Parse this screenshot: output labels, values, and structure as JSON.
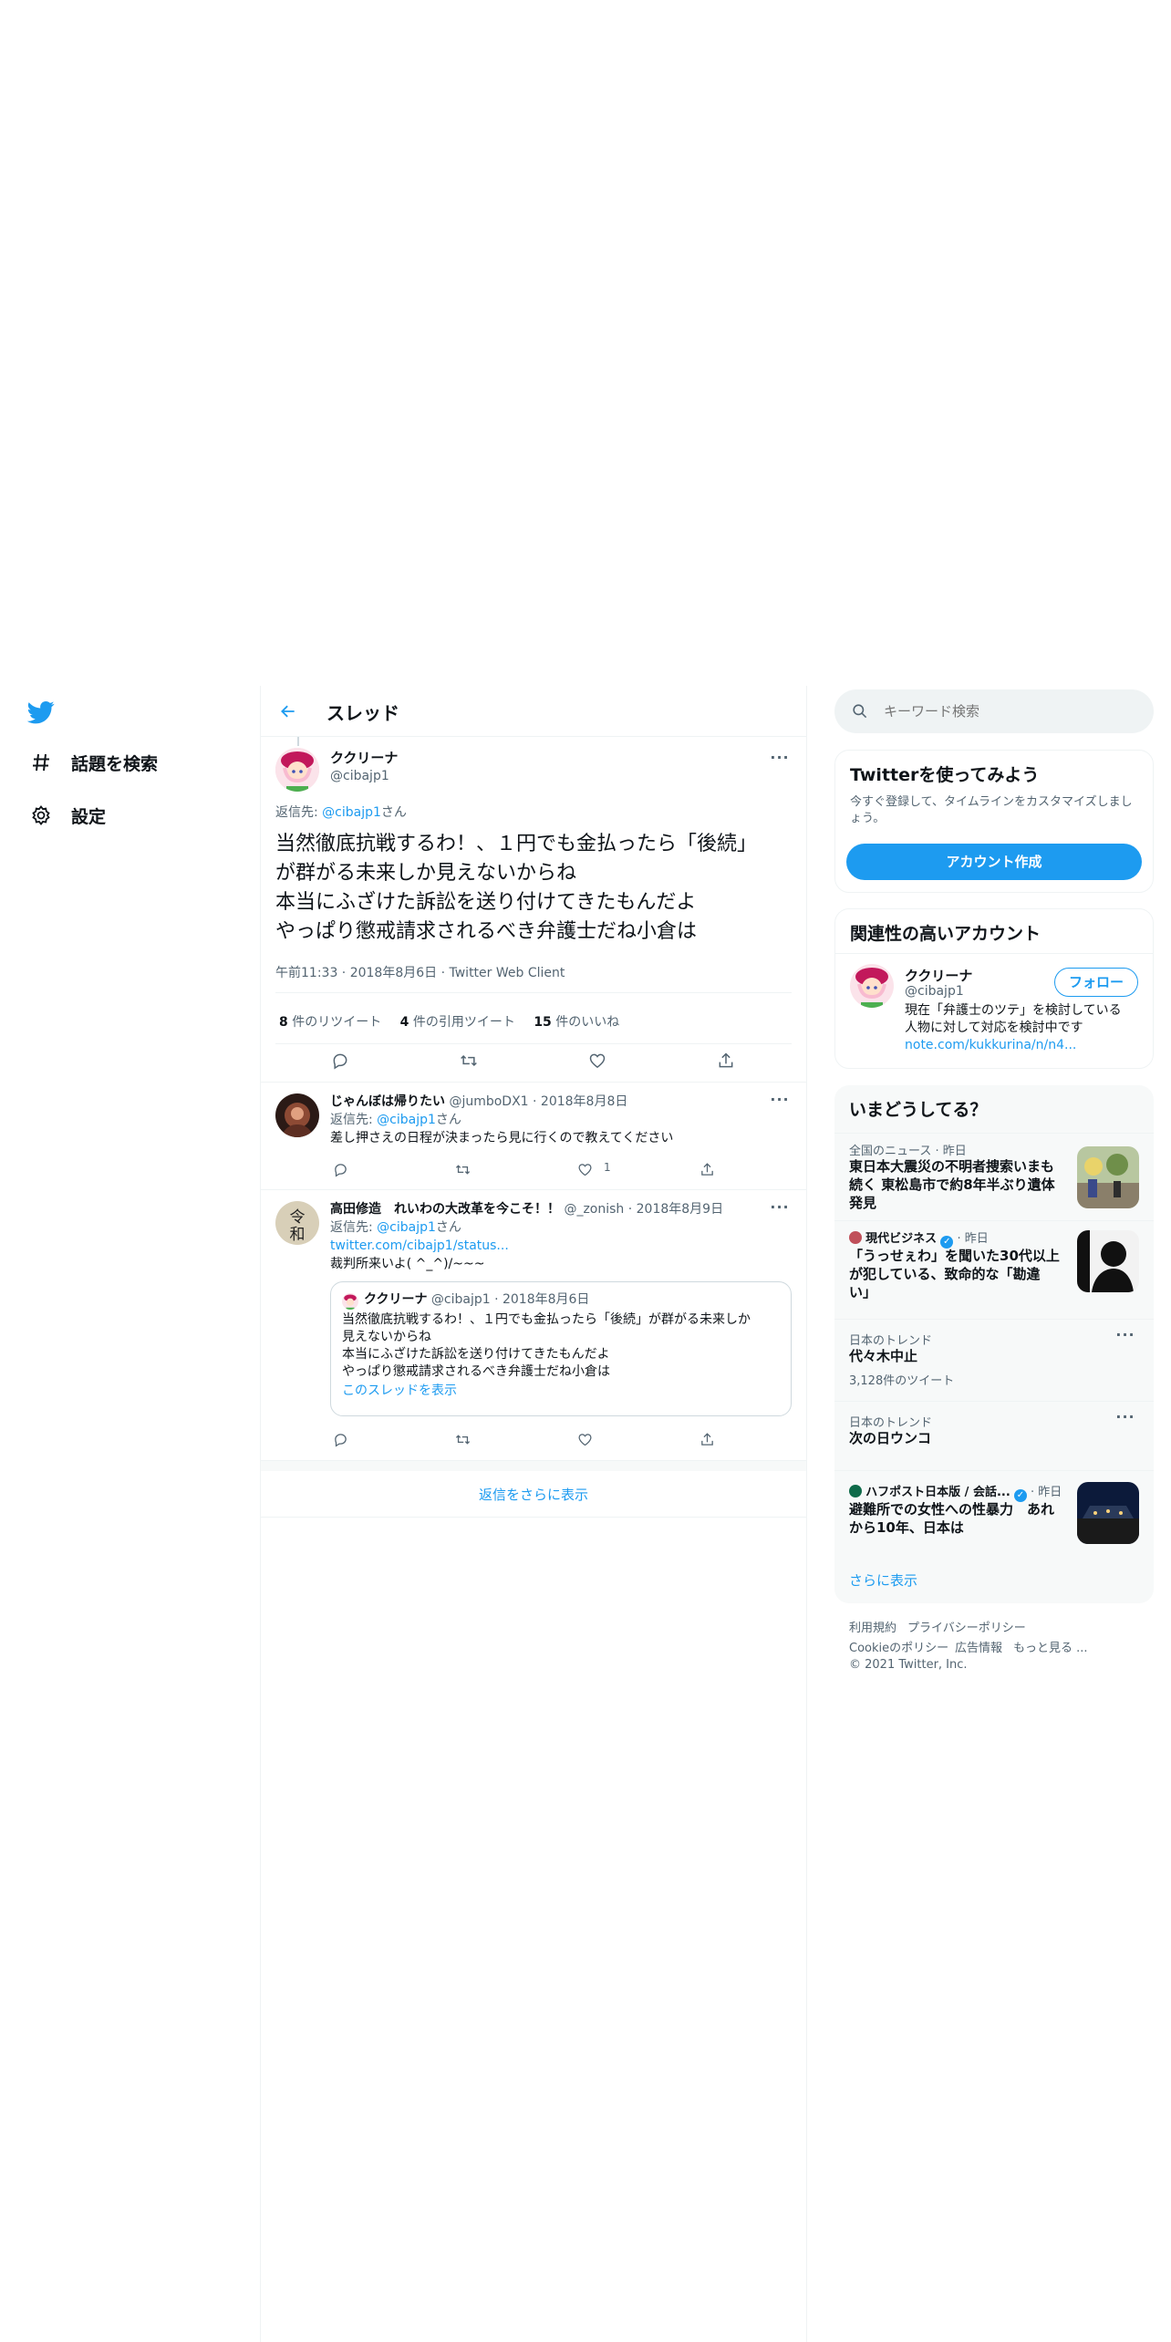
{
  "nav": {
    "explore_label": "話題を検索",
    "settings_label": "設定"
  },
  "header": {
    "title": "スレッド"
  },
  "main_tweet": {
    "display_name": "ククリーナ",
    "handle": "@cibajp1",
    "reply_prefix": "返信先: ",
    "reply_to": "@cibajp1",
    "reply_suffix": "さん",
    "text_lines": [
      "当然徹底抗戦するわ！、１円でも金払ったら「後続」",
      "が群がる未来しか見えないからね",
      "本当にふざけた訴訟を送り付けてきたもんだよ",
      "やっぱり懲戒請求されるべき弁護士だね小倉は"
    ],
    "meta": "午前11:33 · 2018年8月6日 · Twitter Web Client",
    "retweets_count": "8",
    "retweets_label": " 件のリツイート",
    "quotes_count": "4",
    "quotes_label": " 件の引用ツイート",
    "likes_count": "15",
    "likes_label": " 件のいいね"
  },
  "replies": [
    {
      "display_name": "じゃんぼは帰りたい",
      "handle_date": " @jumboDX1 · 2018年8月8日",
      "reply_prefix": "返信先: ",
      "reply_to": "@cibajp1",
      "reply_suffix": "さん",
      "text": "差し押さえの日程が決まったら見に行くので教えてください",
      "like_count": "1"
    },
    {
      "display_name": "高田修造　れいわの大改革を今こそ！！",
      "handle_date": " @_zonish · 2018年8月9日",
      "reply_prefix": "返信先: ",
      "reply_to": "@cibajp1",
      "reply_suffix": "さん",
      "link": "twitter.com/cibajp1/status...",
      "text": "裁判所来いよ( ^_^)/~~~",
      "quote": {
        "display_name": "ククリーナ",
        "handle_date": " @cibajp1 · 2018年8月6日",
        "lines": [
          "当然徹底抗戦するわ！、１円でも金払ったら「後続」が群がる未来しか",
          "見えないからね",
          "本当にふざけた訴訟を送り付けてきたもんだよ",
          "やっぱり懲戒請求されるべき弁護士だね小倉は"
        ],
        "show_thread": "このスレッドを表示"
      }
    }
  ],
  "show_more_replies": "返信をさらに表示",
  "search": {
    "placeholder": "キーワード検索"
  },
  "signup": {
    "title": "Twitterを使ってみよう",
    "desc_line1": "今すぐ登録して、タイムラインをカスタマイズしまし",
    "desc_line2": "ょう。",
    "button": "アカウント作成"
  },
  "related": {
    "title": "関連性の高いアカウント",
    "display_name": "ククリーナ",
    "handle": "@cibajp1",
    "follow": "フォロー",
    "bio_line1": "現在「弁護士のツテ」を検討している",
    "bio_line2": "人物に対して対応を検討中です",
    "bio_link": "note.com/kukkurina/n/n4..."
  },
  "trends": {
    "title": "いまどうしてる？",
    "items": [
      {
        "meta": "全国のニュース · 昨日",
        "title_lines": [
          "東日本大震災の不明者捜索いまも",
          "続く 東松島市で約8年半ぶり遺体",
          "発見"
        ]
      },
      {
        "source": "現代ビジネス",
        "meta_suffix": " · 昨日",
        "title_lines": [
          "「うっせぇわ」を聞いた30代以上",
          "が犯している、致命的な「勘違",
          "い」"
        ]
      },
      {
        "meta": "日本のトレンド",
        "title_lines": [
          "代々木中止"
        ],
        "count": "3,128件のツイート"
      },
      {
        "meta": "日本のトレンド",
        "title_lines": [
          "次の日ウンコ"
        ]
      },
      {
        "source": "ハフポスト日本版 / 会話...",
        "meta_suffix": " · 昨日",
        "title_lines": [
          "避難所での女性への性暴力　あれ",
          "から10年、日本は"
        ]
      }
    ],
    "show_more": "さらに表示"
  },
  "footer": {
    "terms": "利用規約",
    "privacy": "プライバシーポリシー",
    "cookie": "Cookieのポリシー",
    "ads": "広告情報",
    "more": "もっと見る ...",
    "copyright": "© 2021 Twitter, Inc."
  },
  "colors": {
    "accent": "#1d9bf0",
    "text": "#0f1419",
    "muted": "#536471",
    "border": "#eff3f4",
    "panel": "#f7f9f9"
  }
}
